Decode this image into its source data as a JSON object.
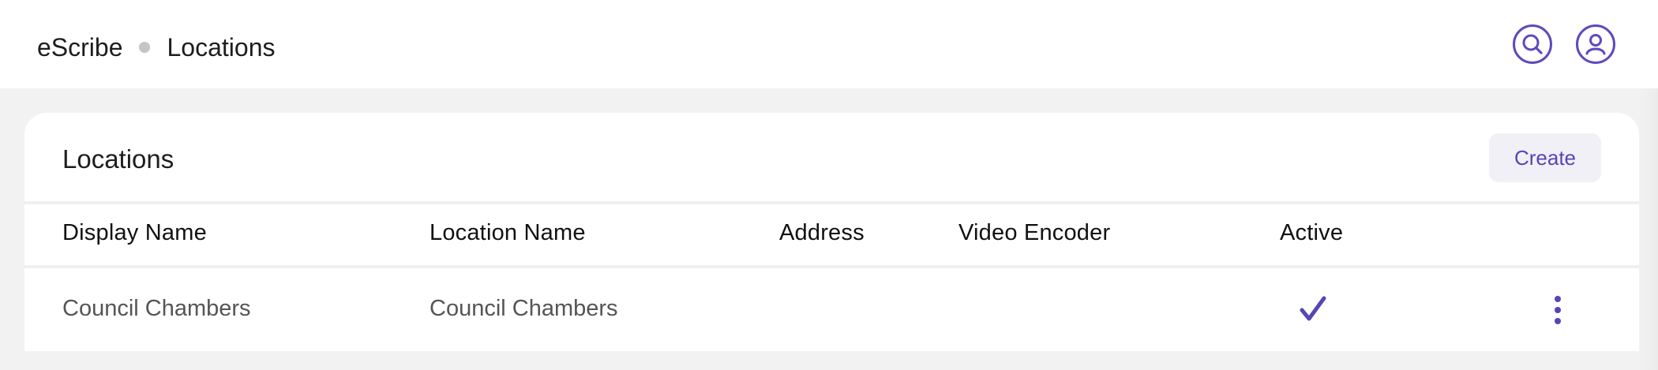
{
  "breadcrumb": {
    "app": "eScribe",
    "page": "Locations"
  },
  "header_icons": {
    "search": "search-icon",
    "user": "user-profile-icon",
    "accent_color": "#5b4bbf"
  },
  "card": {
    "title": "Locations",
    "create_label": "Create"
  },
  "table": {
    "columns": [
      "Display Name",
      "Location Name",
      "Address",
      "Video Encoder",
      "Active"
    ],
    "rows": [
      {
        "display_name": "Council Chambers",
        "location_name": "Council Chambers",
        "address": "",
        "video_encoder": "",
        "active": true,
        "active_icon": "checkmark-icon",
        "actions_icon": "more-vertical-icon"
      }
    ]
  }
}
